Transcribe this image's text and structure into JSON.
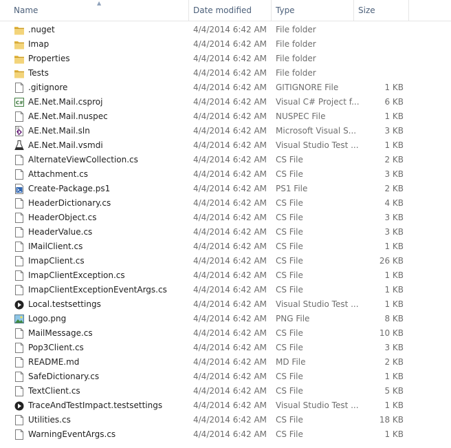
{
  "columns": {
    "name": "Name",
    "date_modified": "Date modified",
    "type": "Type",
    "size": "Size"
  },
  "files": [
    {
      "name": ".nuget",
      "date": "4/4/2014 6:42 AM",
      "type": "File folder",
      "size": "",
      "icon": "folder-icon"
    },
    {
      "name": "Imap",
      "date": "4/4/2014 6:42 AM",
      "type": "File folder",
      "size": "",
      "icon": "folder-icon"
    },
    {
      "name": "Properties",
      "date": "4/4/2014 6:42 AM",
      "type": "File folder",
      "size": "",
      "icon": "folder-icon"
    },
    {
      "name": "Tests",
      "date": "4/4/2014 6:42 AM",
      "type": "File folder",
      "size": "",
      "icon": "folder-icon"
    },
    {
      "name": ".gitignore",
      "date": "4/4/2014 6:42 AM",
      "type": "GITIGNORE File",
      "size": "1 KB",
      "icon": "file-icon"
    },
    {
      "name": "AE.Net.Mail.csproj",
      "date": "4/4/2014 6:42 AM",
      "type": "Visual C# Project f...",
      "size": "6 KB",
      "icon": "csproj-icon"
    },
    {
      "name": "AE.Net.Mail.nuspec",
      "date": "4/4/2014 6:42 AM",
      "type": "NUSPEC File",
      "size": "1 KB",
      "icon": "file-icon"
    },
    {
      "name": "AE.Net.Mail.sln",
      "date": "4/4/2014 6:42 AM",
      "type": "Microsoft Visual S...",
      "size": "3 KB",
      "icon": "sln-icon"
    },
    {
      "name": "AE.Net.Mail.vsmdi",
      "date": "4/4/2014 6:42 AM",
      "type": "Visual Studio Test ...",
      "size": "1 KB",
      "icon": "flask-icon"
    },
    {
      "name": "AlternateViewCollection.cs",
      "date": "4/4/2014 6:42 AM",
      "type": "CS File",
      "size": "2 KB",
      "icon": "file-icon"
    },
    {
      "name": "Attachment.cs",
      "date": "4/4/2014 6:42 AM",
      "type": "CS File",
      "size": "3 KB",
      "icon": "file-icon"
    },
    {
      "name": "Create-Package.ps1",
      "date": "4/4/2014 6:42 AM",
      "type": "PS1 File",
      "size": "2 KB",
      "icon": "powershell-icon"
    },
    {
      "name": "HeaderDictionary.cs",
      "date": "4/4/2014 6:42 AM",
      "type": "CS File",
      "size": "4 KB",
      "icon": "file-icon"
    },
    {
      "name": "HeaderObject.cs",
      "date": "4/4/2014 6:42 AM",
      "type": "CS File",
      "size": "3 KB",
      "icon": "file-icon"
    },
    {
      "name": "HeaderValue.cs",
      "date": "4/4/2014 6:42 AM",
      "type": "CS File",
      "size": "3 KB",
      "icon": "file-icon"
    },
    {
      "name": "IMailClient.cs",
      "date": "4/4/2014 6:42 AM",
      "type": "CS File",
      "size": "1 KB",
      "icon": "file-icon"
    },
    {
      "name": "ImapClient.cs",
      "date": "4/4/2014 6:42 AM",
      "type": "CS File",
      "size": "26 KB",
      "icon": "file-icon"
    },
    {
      "name": "ImapClientException.cs",
      "date": "4/4/2014 6:42 AM",
      "type": "CS File",
      "size": "1 KB",
      "icon": "file-icon"
    },
    {
      "name": "ImapClientExceptionEventArgs.cs",
      "date": "4/4/2014 6:42 AM",
      "type": "CS File",
      "size": "1 KB",
      "icon": "file-icon"
    },
    {
      "name": "Local.testsettings",
      "date": "4/4/2014 6:42 AM",
      "type": "Visual Studio Test ...",
      "size": "1 KB",
      "icon": "testsettings-icon"
    },
    {
      "name": "Logo.png",
      "date": "4/4/2014 6:42 AM",
      "type": "PNG File",
      "size": "8 KB",
      "icon": "image-icon"
    },
    {
      "name": "MailMessage.cs",
      "date": "4/4/2014 6:42 AM",
      "type": "CS File",
      "size": "10 KB",
      "icon": "file-icon"
    },
    {
      "name": "Pop3Client.cs",
      "date": "4/4/2014 6:42 AM",
      "type": "CS File",
      "size": "3 KB",
      "icon": "file-icon"
    },
    {
      "name": "README.md",
      "date": "4/4/2014 6:42 AM",
      "type": "MD File",
      "size": "2 KB",
      "icon": "file-icon"
    },
    {
      "name": "SafeDictionary.cs",
      "date": "4/4/2014 6:42 AM",
      "type": "CS File",
      "size": "1 KB",
      "icon": "file-icon"
    },
    {
      "name": "TextClient.cs",
      "date": "4/4/2014 6:42 AM",
      "type": "CS File",
      "size": "5 KB",
      "icon": "file-icon"
    },
    {
      "name": "TraceAndTestImpact.testsettings",
      "date": "4/4/2014 6:42 AM",
      "type": "Visual Studio Test ...",
      "size": "1 KB",
      "icon": "testsettings-icon"
    },
    {
      "name": "Utilities.cs",
      "date": "4/4/2014 6:42 AM",
      "type": "CS File",
      "size": "18 KB",
      "icon": "file-icon"
    },
    {
      "name": "WarningEventArgs.cs",
      "date": "4/4/2014 6:42 AM",
      "type": "CS File",
      "size": "1 KB",
      "icon": "file-icon"
    }
  ],
  "colors": {
    "header_text": "#4c607a",
    "folder": "#e8c25a",
    "muted_text": "#6d6d6d"
  }
}
